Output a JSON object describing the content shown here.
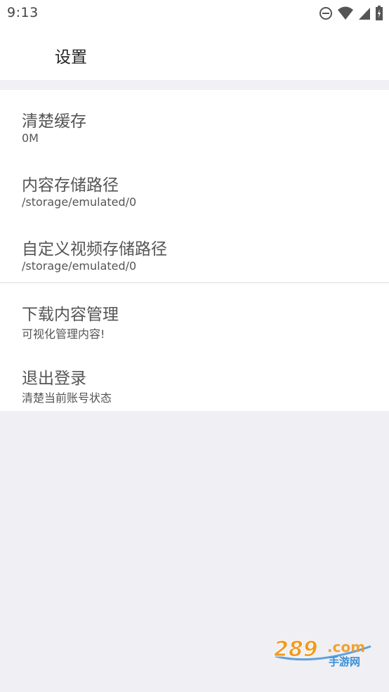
{
  "status_bar": {
    "time": "9:13",
    "icons": [
      "dnd-icon",
      "wifi-icon",
      "signal-icon",
      "battery-icon"
    ]
  },
  "app_bar": {
    "title": "设置"
  },
  "settings": {
    "group1": [
      {
        "title": "清楚缓存",
        "subtitle": "0M"
      },
      {
        "title": "内容存储路径",
        "subtitle": "/storage/emulated/0"
      },
      {
        "title": "自定义视频存储路径",
        "subtitle": "/storage/emulated/0"
      }
    ],
    "group2": [
      {
        "title": "下载内容管理",
        "subtitle": "可视化管理内容!"
      },
      {
        "title": "退出登录",
        "subtitle": "清楚当前账号状态"
      }
    ]
  },
  "watermark": {
    "text": "289.com",
    "subtext": "手游网"
  },
  "colors": {
    "background": "#efeff4",
    "surface": "#ffffff",
    "text": "#555555",
    "watermark_orange": "#f39a1e",
    "watermark_blue": "#3a8fd6"
  }
}
